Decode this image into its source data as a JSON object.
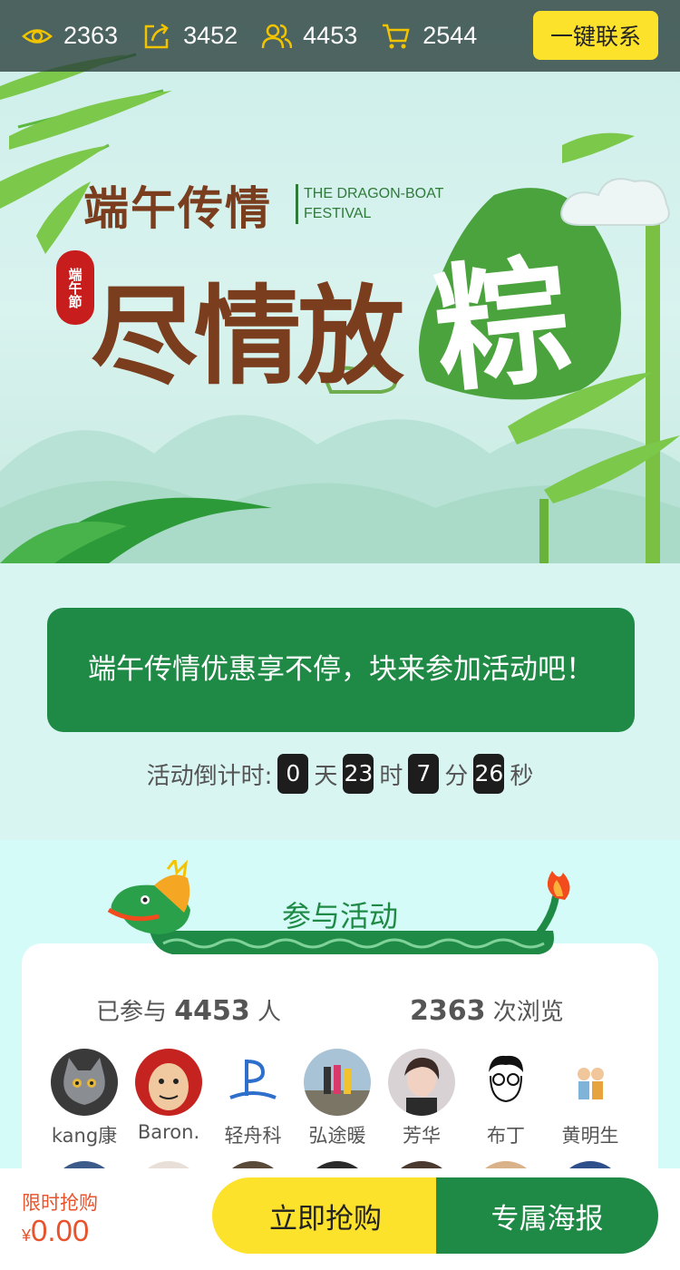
{
  "stats": {
    "views": "2363",
    "shares": "3452",
    "participants": "4453",
    "orders": "2544",
    "contact_label": "一键联系"
  },
  "banner": {
    "title_small": "端午传情",
    "title_en_1": "THE DRAGON-BOAT",
    "title_en_2": "FESTIVAL",
    "title_big": "尽情放",
    "title_zongzi": "粽",
    "seal": "端午節"
  },
  "activity": {
    "slogan": "端午传情优惠享不停，块来参加活动吧！",
    "countdown_label": "活动倒计时:",
    "days": "0",
    "days_unit": "天",
    "hours": "23",
    "hours_unit": "时",
    "minutes": "7",
    "minutes_unit": "分",
    "seconds": "26",
    "seconds_unit": "秒"
  },
  "participation": {
    "title": "参与活动",
    "joined_prefix": "已参与",
    "joined_count": "4453",
    "joined_suffix": "人",
    "views_count": "2363",
    "views_suffix": "次浏览",
    "participants": [
      {
        "name": "kang康"
      },
      {
        "name": "Baron."
      },
      {
        "name": "轻舟科"
      },
      {
        "name": "弘途暖"
      },
      {
        "name": "芳华"
      },
      {
        "name": "布丁"
      },
      {
        "name": "黄明生"
      }
    ]
  },
  "bottom": {
    "promo_label": "限时抢购",
    "currency": "¥",
    "price": "0.00",
    "buy_label": "立即抢购",
    "poster_label": "专属海报"
  },
  "colors": {
    "brand_green": "#1f8a45",
    "accent_yellow": "#fde22b",
    "price_orange": "#e8532c"
  }
}
